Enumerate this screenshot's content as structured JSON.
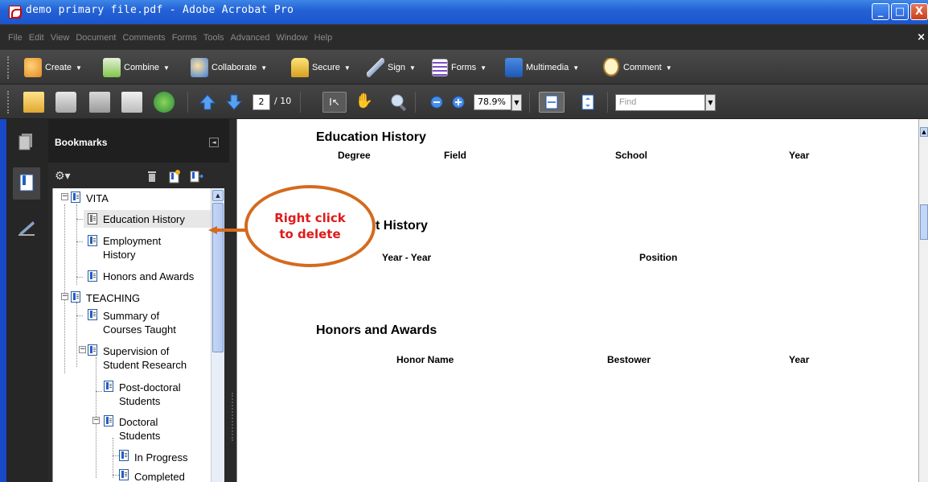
{
  "window": {
    "title": "demo primary file.pdf - Adobe Acrobat Pro",
    "minimize": "_",
    "maximize": "□",
    "close": "X"
  },
  "menu": {
    "items": [
      "File",
      "Edit",
      "View",
      "Document",
      "Comments",
      "Forms",
      "Tools",
      "Advanced",
      "Window",
      "Help"
    ],
    "close": "×"
  },
  "tasks": {
    "create": "Create",
    "combine": "Combine",
    "collaborate": "Collaborate",
    "secure": "Secure",
    "sign": "Sign",
    "forms": "Forms",
    "multimedia": "Multimedia",
    "comment": "Comment",
    "caret": "▼"
  },
  "toolbar": {
    "page_current": "2",
    "page_total": "/ 10",
    "zoom": "78.9%",
    "find_placeholder": "Find",
    "dropdown": "▼"
  },
  "panel": {
    "title": "Bookmarks",
    "collapse": "◄"
  },
  "bookmarks": {
    "vita": "VITA",
    "education_history": "Education History",
    "employment_history_1": "Employment",
    "employment_history_2": "History",
    "honors_awards": "Honors and Awards",
    "teaching": "TEACHING",
    "summary_1": "Summary of",
    "summary_2": "Courses Taught",
    "supervision_1": "Supervision of",
    "supervision_2": "Student Research",
    "postdoc_1": "Post-doctoral",
    "postdoc_2": "Students",
    "doctoral_1": "Doctoral",
    "doctoral_2": "Students",
    "in_progress": "In Progress",
    "completed": "Completed",
    "expander_minus": "−"
  },
  "document": {
    "education_heading": "Education History",
    "education_cols": [
      "Degree",
      "Field",
      "School",
      "Year"
    ],
    "employment_heading_partial": "t History",
    "employment_cols": [
      "Year - Year",
      "Position"
    ],
    "honors_heading": "Honors and Awards",
    "honors_cols": [
      "Honor Name",
      "Bestower",
      "Year"
    ]
  },
  "callout": {
    "line1": "Right click",
    "line2": "to delete",
    "color": "#d46a1e",
    "text_color": "#e01a1a"
  }
}
